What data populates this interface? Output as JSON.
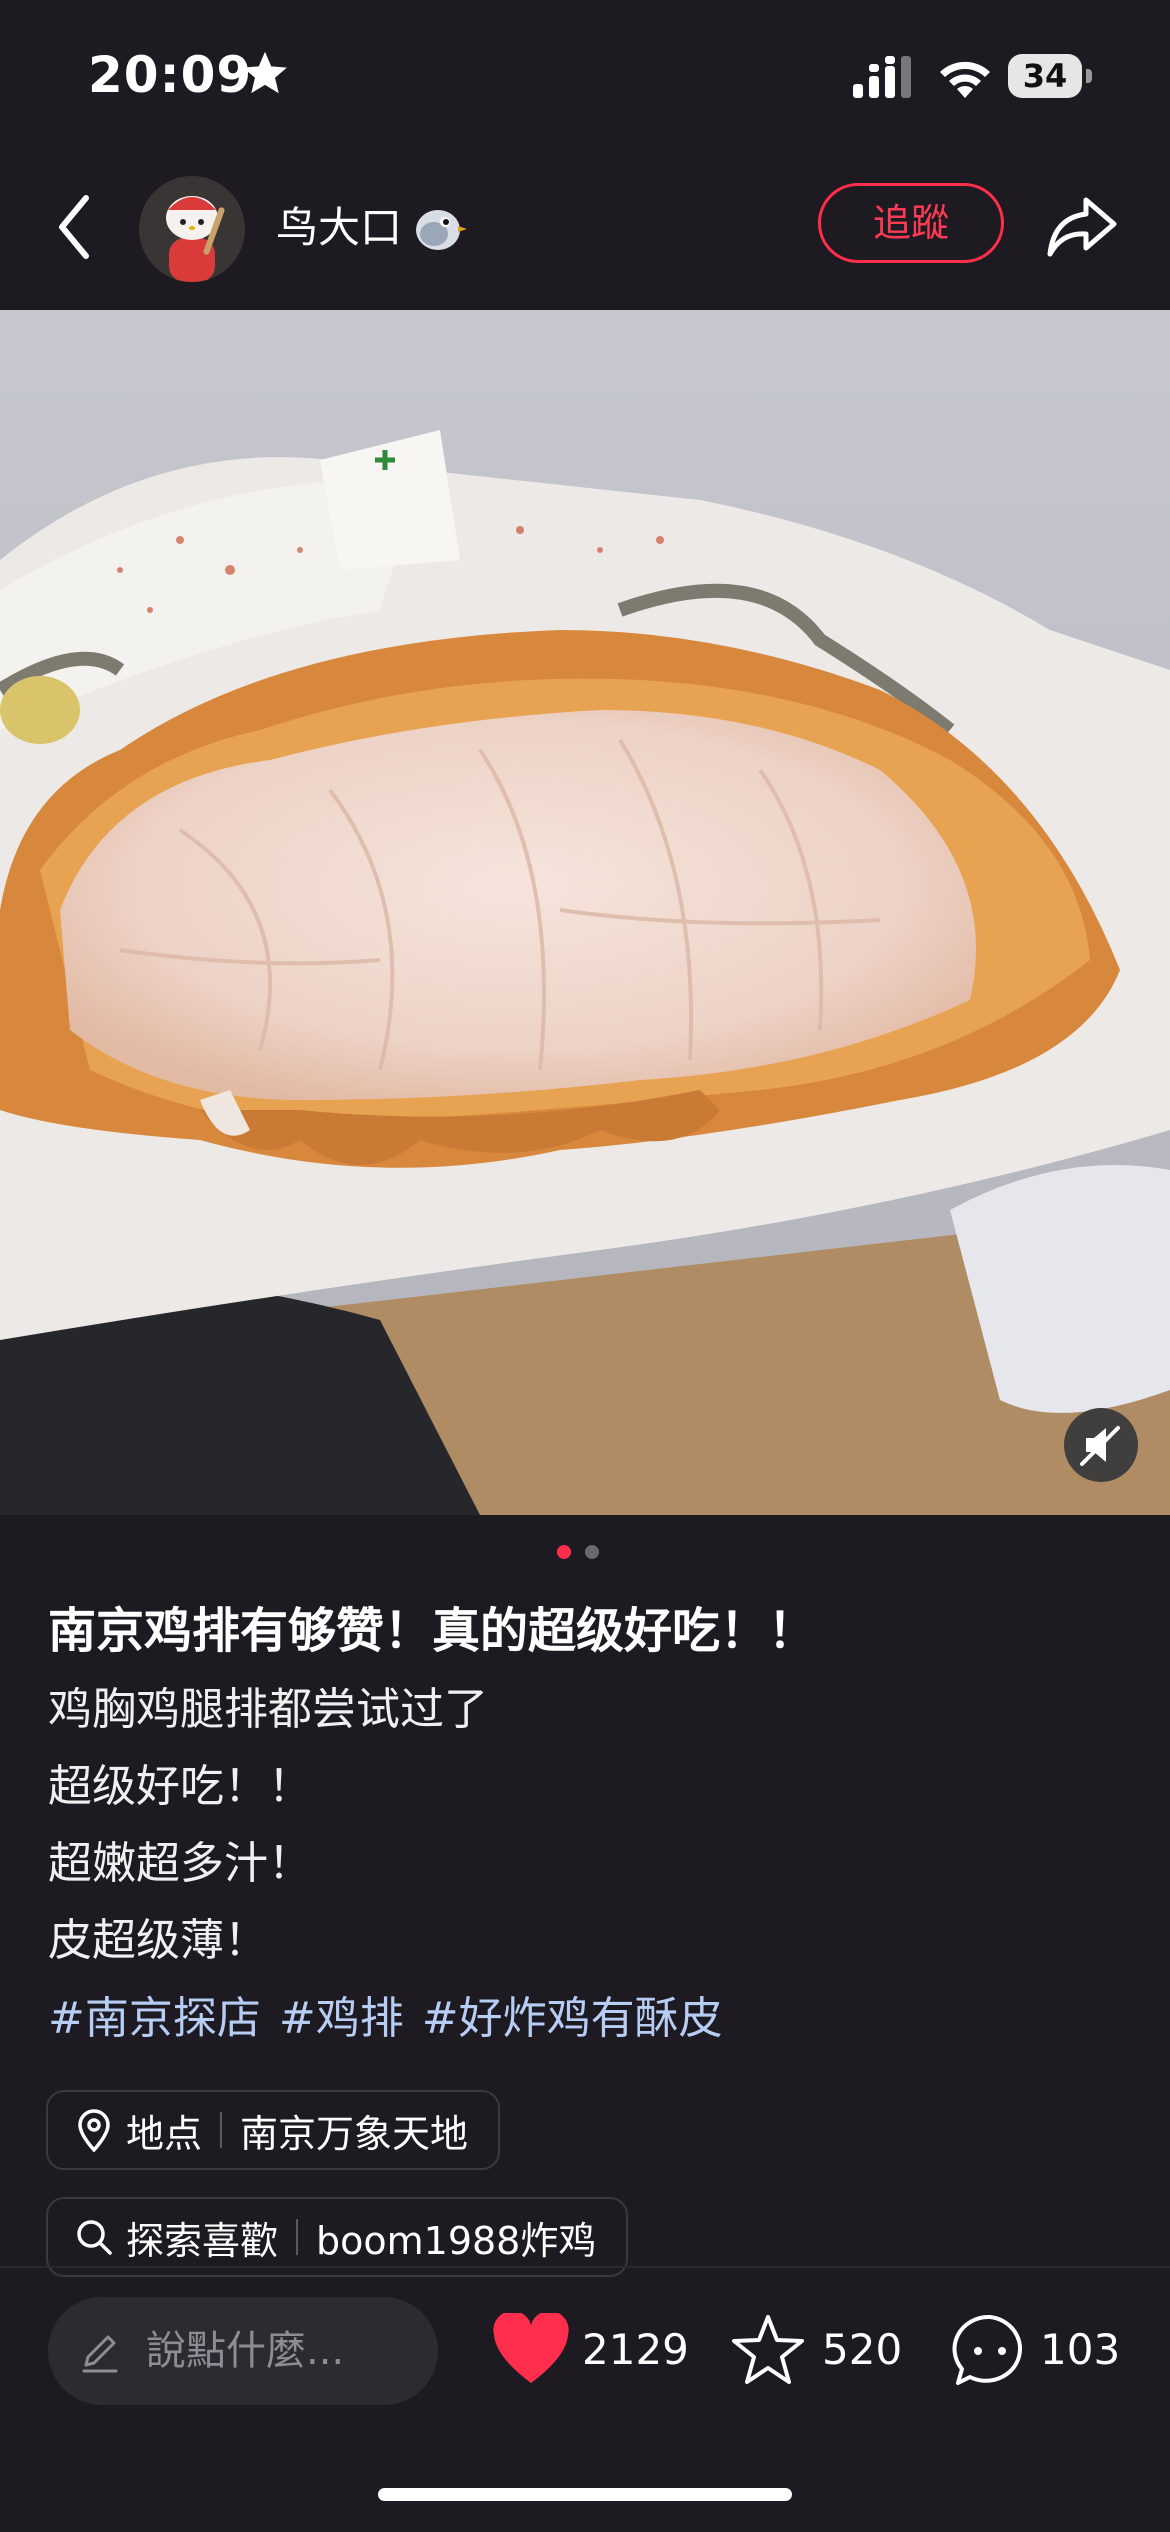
{
  "status_bar": {
    "time": "20:09",
    "battery": "34"
  },
  "header": {
    "username": "鸟大口",
    "follow_label": "追蹤"
  },
  "post": {
    "title": "南京鸡排有够赞！真的超级好吃！！",
    "lines": [
      "鸡胸鸡腿排都尝试过了",
      "超级好吃！！",
      "超嫩超多汁！",
      "皮超级薄！"
    ],
    "tags": [
      "#南京探店",
      "#鸡排",
      "#好炸鸡有酥皮"
    ],
    "location": {
      "label": "地点",
      "value": "南京万象天地"
    },
    "explore": {
      "label": "探索喜歡",
      "value": "boom1988炸鸡"
    },
    "image_count": 2,
    "current_image": 1
  },
  "bottom_bar": {
    "comment_placeholder": "說點什麼...",
    "likes": "2129",
    "favorites": "520",
    "comments": "103"
  },
  "colors": {
    "accent": "#ff2e4d",
    "background": "#1d1b21",
    "tag": "#b7cdf4"
  }
}
